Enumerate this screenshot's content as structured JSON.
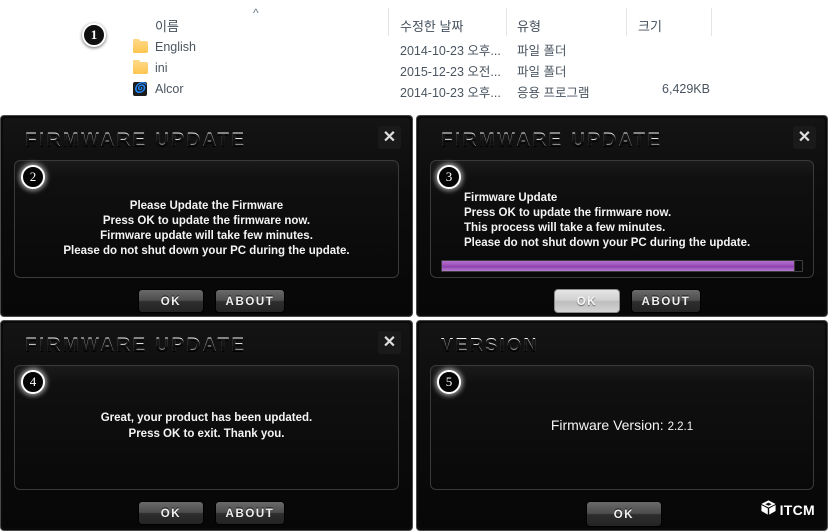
{
  "explorer": {
    "badge": "1",
    "sort_caret": "^",
    "columns": [
      {
        "label": "이름"
      },
      {
        "label": "수정한 날짜"
      },
      {
        "label": "유형"
      },
      {
        "label": "크기"
      }
    ],
    "rows": [
      {
        "icon": "folder-icon",
        "name": "English",
        "date": "2014-10-23 오후...",
        "type": "파일 폴더",
        "size": ""
      },
      {
        "icon": "folder-icon",
        "name": "ini",
        "date": "2015-12-23 오전...",
        "type": "파일 폴더",
        "size": ""
      },
      {
        "icon": "app-icon",
        "name": "Alcor",
        "date": "2014-10-23 오후...",
        "type": "응용 프로그램",
        "size": "6,429KB"
      }
    ]
  },
  "dialogs": {
    "d2": {
      "badge": "2",
      "title": "Firmware Update",
      "close_label": "✕",
      "lines": [
        "Please Update the Firmware",
        "Press OK to update the firmware now.",
        "Firmware update will take few minutes.",
        "Please do not shut down your PC during the update."
      ],
      "buttons": [
        {
          "label": "Ok",
          "style": "dark"
        },
        {
          "label": "About",
          "style": "dark"
        }
      ]
    },
    "d3": {
      "badge": "3",
      "title": "Firmware Update",
      "close_label": "✕",
      "lines": [
        "Firmware Update",
        "Press OK to update the firmware now.",
        "This process will take a few minutes.",
        "Please do not shut down your PC during the update."
      ],
      "progress_percent": 98,
      "progress_color": "#a052c0",
      "buttons": [
        {
          "label": "Ok",
          "style": "light"
        },
        {
          "label": "About",
          "style": "dark"
        }
      ]
    },
    "d4": {
      "badge": "4",
      "title": "Firmware Update",
      "close_label": "✕",
      "lines": [
        "Great, your product has been updated.",
        "Press OK to exit. Thank you."
      ],
      "buttons": [
        {
          "label": "Ok",
          "style": "dark"
        },
        {
          "label": "About",
          "style": "dark"
        }
      ]
    },
    "d5": {
      "badge": "5",
      "title": "Version",
      "version_label": "Firmware Version:",
      "version_value": "2.2.1",
      "buttons": [
        {
          "label": "Ok",
          "style": "dark"
        }
      ],
      "logo_text": "ITCM"
    }
  }
}
